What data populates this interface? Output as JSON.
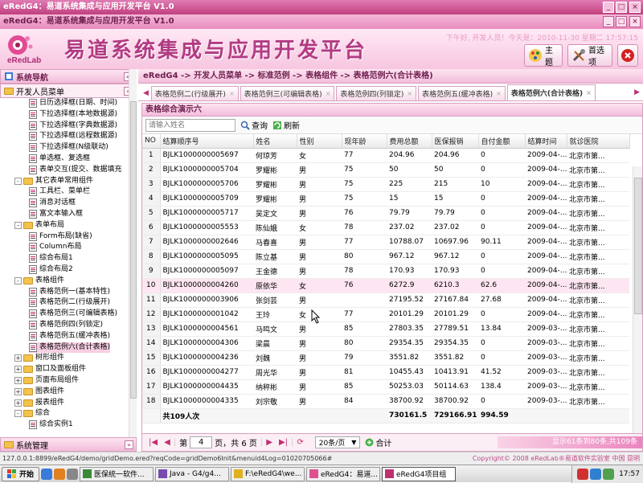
{
  "window": {
    "title": "eRedG4：易道系统集成与应用开发平台 V1.0"
  },
  "app": {
    "title": "eRedG4：易道系统集成与应用开发平台 V1.0"
  },
  "header": {
    "logo_text": "eRedLab",
    "platform_title": "易道系统集成与应用开发平台",
    "welcome": "下午好, 开发人员！今天是：2010-11-30 星期二 17:57:15",
    "theme_label": "主题",
    "pref_label": "首选项"
  },
  "nav": {
    "title": "系统导航",
    "root": "开发人员菜单",
    "items": [
      "日历选择框(日期、时间)",
      "下拉选择框(本地数据源)",
      "下拉选择框(字典数据源)",
      "下拉选择框(远程数据源)",
      "下拉选择框(N级联动)",
      "单选框、复选框",
      "表单交互(提交、数据填充",
      "其它表单常用组件",
      "工具栏、菜单栏",
      "消息对话框",
      "富文本输入框",
      "表单布局",
      "Form布局(缺省)",
      "Column布局",
      "综合布局1",
      "综合布局2",
      "表格组件",
      "表格范例一(基本特性)",
      "表格范例二(行级展开)",
      "表格范例三(可编辑表格)",
      "表格范例四(列锁定)",
      "表格范例五(缓冲表格)",
      "表格范例六(合计表格)",
      "树形组件",
      "窗口及面板组件",
      "页面布局组件",
      "图表组件",
      "报表组件",
      "综合",
      "综合实例1"
    ],
    "system": "系统管理"
  },
  "breadcrumb": "eRedG4 -> 开发人员菜单 -> 标准范例 -> 表格组件 -> 表格范例六(合计表格)",
  "tabs": [
    "表格范例二(行级展开)",
    "表格范例三(可编辑表格)",
    "表格范例四(列锁定)",
    "表格范例五(缓冲表格)",
    "表格范例六(合计表格)"
  ],
  "grid": {
    "title": "表格综合演示六",
    "search_placeholder": "请输入姓名",
    "query_label": "查询",
    "refresh_label": "刷新",
    "columns": [
      "NO",
      "结算顺序号",
      "姓名",
      "性别",
      "现年龄",
      "费用总额",
      "医保报销",
      "自付金额",
      "结算时间",
      "就诊医院"
    ],
    "rows": [
      [
        "1",
        "BJLK1000000005697",
        "何琼芳",
        "女",
        "77",
        "204.96",
        "204.96",
        "0",
        "2009-04-...",
        "北京市第..."
      ],
      [
        "2",
        "BJLK1000000005704",
        "罗耀彬",
        "男",
        "75",
        "50",
        "50",
        "0",
        "2009-04-...",
        "北京市第..."
      ],
      [
        "3",
        "BJLK1000000005706",
        "罗耀彬",
        "男",
        "75",
        "225",
        "215",
        "10",
        "2009-04-...",
        "北京市第..."
      ],
      [
        "4",
        "BJLK1000000005709",
        "罗耀彬",
        "男",
        "75",
        "15",
        "15",
        "0",
        "2009-04-...",
        "北京市第..."
      ],
      [
        "5",
        "BJLK1000000005717",
        "吴定文",
        "男",
        "76",
        "79.79",
        "79.79",
        "0",
        "2009-04-...",
        "北京市第..."
      ],
      [
        "6",
        "BJLK1000000005553",
        "陈仙娥",
        "女",
        "78",
        "237.02",
        "237.02",
        "0",
        "2009-04-...",
        "北京市第..."
      ],
      [
        "7",
        "BJLK1000000002646",
        "马春喜",
        "男",
        "77",
        "10788.07",
        "10697.96",
        "90.11",
        "2009-04-...",
        "北京市第..."
      ],
      [
        "8",
        "BJLK1000000005095",
        "陈立基",
        "男",
        "80",
        "967.12",
        "967.12",
        "0",
        "2009-04-...",
        "北京市第..."
      ],
      [
        "9",
        "BJLK1000000005097",
        "王金德",
        "男",
        "78",
        "170.93",
        "170.93",
        "0",
        "2009-04-...",
        "北京市第..."
      ],
      [
        "10",
        "BJLK1000000004260",
        "原依华",
        "女",
        "76",
        "6272.9",
        "6210.3",
        "62.6",
        "2009-04-...",
        "北京市第..."
      ],
      [
        "11",
        "BJLK1000000003906",
        "张剑芸",
        "男",
        "",
        "27195.52",
        "27167.84",
        "27.68",
        "2009-04-...",
        "北京市第..."
      ],
      [
        "12",
        "BJLK1000000001042",
        "王玲",
        "女",
        "77",
        "20101.29",
        "20101.29",
        "0",
        "2009-04-...",
        "北京市第..."
      ],
      [
        "13",
        "BJLK1000000004561",
        "马鸣文",
        "男",
        "85",
        "27803.35",
        "27789.51",
        "13.84",
        "2009-03-...",
        "北京市第..."
      ],
      [
        "14",
        "BJLK1000000004306",
        "梁晨",
        "男",
        "80",
        "29354.35",
        "29354.35",
        "0",
        "2009-03-...",
        "北京市第..."
      ],
      [
        "15",
        "BJLK1000000004236",
        "刘魏",
        "男",
        "79",
        "3551.82",
        "3551.82",
        "0",
        "2009-03-...",
        "北京市第..."
      ],
      [
        "16",
        "BJLK1000000004277",
        "周光华",
        "男",
        "81",
        "10455.43",
        "10413.91",
        "41.52",
        "2009-03-...",
        "北京市第..."
      ],
      [
        "17",
        "BJLK1000000004435",
        "纳秤彬",
        "男",
        "85",
        "50253.03",
        "50114.63",
        "138.4",
        "2009-03-...",
        "北京市第..."
      ],
      [
        "18",
        "BJLK1000000004335",
        "刘宗敬",
        "男",
        "84",
        "38700.92",
        "38700.92",
        "0",
        "2009-03-...",
        "北京市第..."
      ]
    ],
    "total": {
      "label": "共109人次",
      "fee": "730161.5",
      "ins": "729166.91",
      "self": "994.59"
    },
    "highlight_row": 10
  },
  "pager": {
    "page_prefix": "第",
    "page_value": "4",
    "page_suffix": "页，共 6 页",
    "page_size": "20条/页",
    "sum_label": "合计",
    "info": "显示61条到80条,共109条"
  },
  "status": {
    "url": "127.0.0.1:8899/eRedG4/demo/gridDemo.ered?reqCode=gridDemo6Init&menuid4Log=01020705066#",
    "copyright": "Copyright© 2008 eRedLab®易道软件实验室 中国 昆明"
  },
  "taskbar": {
    "start": "开始",
    "items": [
      "医保统一软件...",
      "Java - G4/g4...",
      "F:\\eRedG4\\we...",
      "eRedG4：易道...",
      "eRedG4项目组"
    ],
    "clock": "17:57"
  },
  "colors": {
    "accent": "#c03070",
    "header_bg": "#f7c6e0",
    "title_bar": "#c0407e"
  }
}
